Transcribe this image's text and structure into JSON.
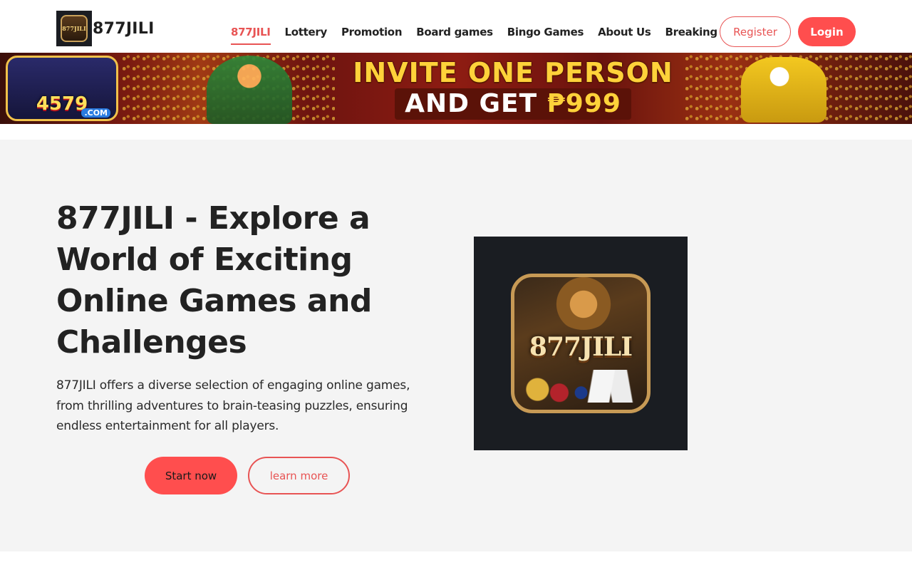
{
  "brand": {
    "name": "877JILI",
    "logo_mini": "877JILI"
  },
  "nav": {
    "items": [
      {
        "label": "877JILI",
        "active": true
      },
      {
        "label": "Lottery"
      },
      {
        "label": "Promotion"
      },
      {
        "label": "Board games"
      },
      {
        "label": "Bingo Games"
      },
      {
        "label": "About Us"
      },
      {
        "label": "Breaking News"
      }
    ],
    "register_label": "Register",
    "login_label": "Login"
  },
  "banner": {
    "site_badge": "4579",
    "site_badge_sub": ".COM",
    "line1": "INVITE ONE PERSON",
    "line2_prefix": "AND GET ",
    "line2_amount": "₱999"
  },
  "hero": {
    "title": "877JILI - Explore a World of Exciting Online Games and Challenges",
    "description": "877JILI offers a diverse selection of engaging online games, from thrilling adventures to brain-teasing puzzles, ensuring endless entertainment for all players.",
    "start_label": "Start now",
    "learn_label": "learn more",
    "image_app_name": "877JILI"
  },
  "colors": {
    "accent": "#ff4e4e",
    "accent_text": "#e85454",
    "hero_bg": "#f4f4f4"
  }
}
